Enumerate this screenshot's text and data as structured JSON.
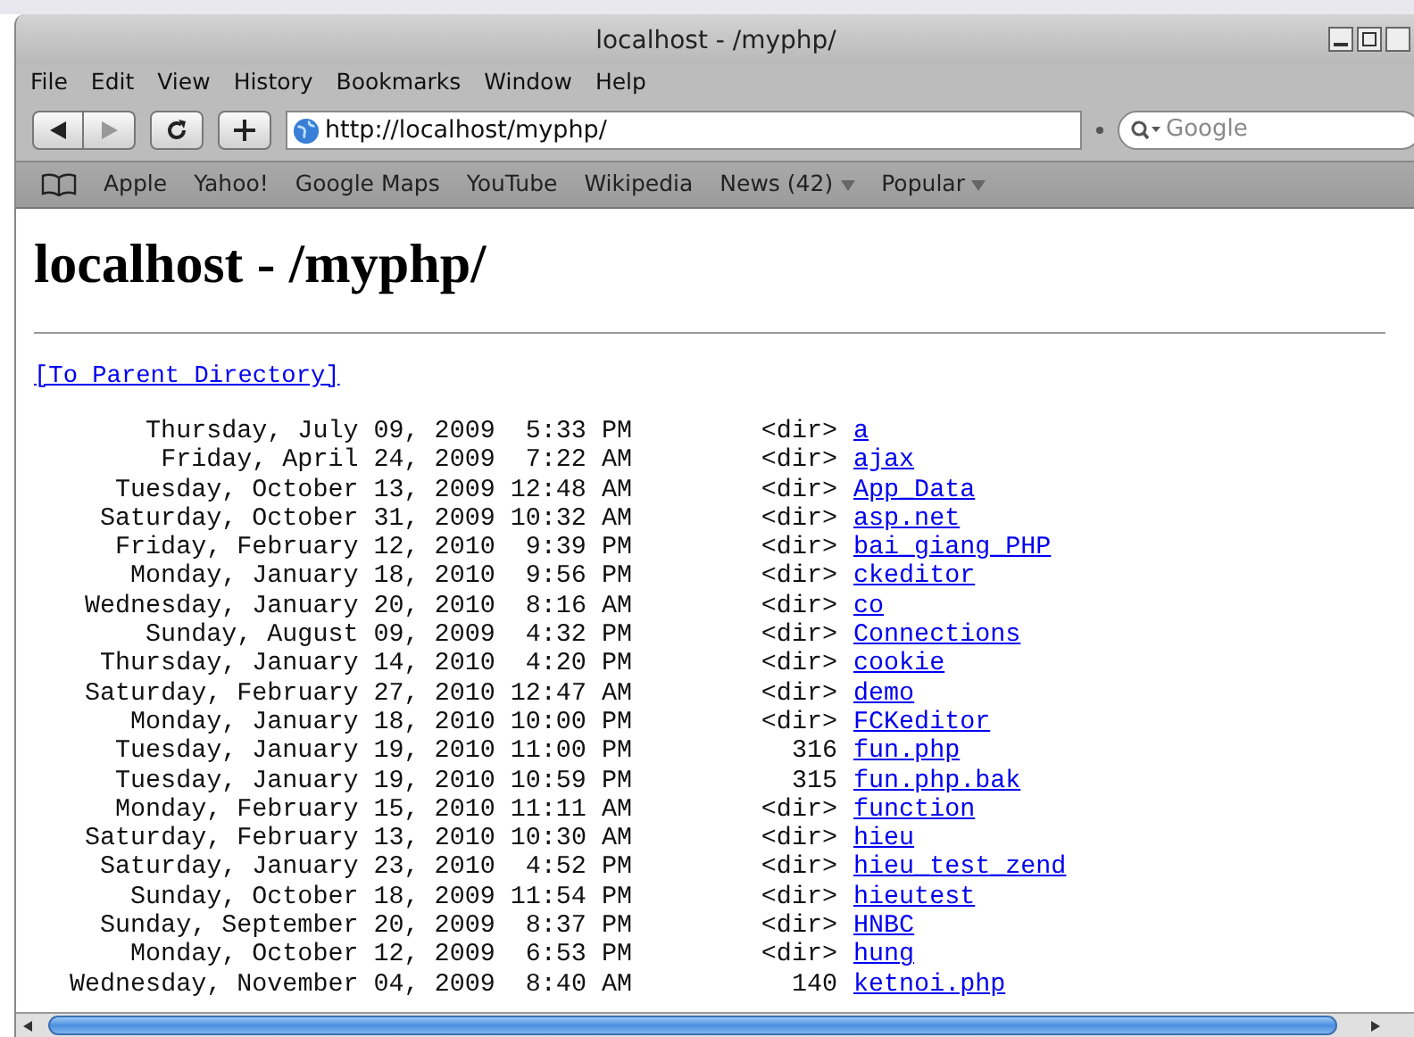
{
  "window": {
    "title": "localhost - /myphp/"
  },
  "menu": [
    "File",
    "Edit",
    "View",
    "History",
    "Bookmarks",
    "Window",
    "Help"
  ],
  "toolbar": {
    "url": "http://localhost/myphp/",
    "search": {
      "placeholder": "Google"
    }
  },
  "bookmarks": [
    {
      "label": "Apple",
      "kind": "link"
    },
    {
      "label": "Yahoo!",
      "kind": "link"
    },
    {
      "label": "Google Maps",
      "kind": "link"
    },
    {
      "label": "YouTube",
      "kind": "link"
    },
    {
      "label": "Wikipedia",
      "kind": "link"
    },
    {
      "label": "News (42)",
      "kind": "menu"
    },
    {
      "label": "Popular",
      "kind": "menu"
    }
  ],
  "page": {
    "heading": "localhost - /myphp/",
    "parent_link": "[To Parent Directory]",
    "rows": [
      {
        "date": "Thursday, July 09, 2009  5:33 PM",
        "size": "<dir>",
        "name": "a"
      },
      {
        "date": "Friday, April 24, 2009  7:22 AM",
        "size": "<dir>",
        "name": "ajax"
      },
      {
        "date": "Tuesday, October 13, 2009 12:48 AM",
        "size": "<dir>",
        "name": "App_Data"
      },
      {
        "date": "Saturday, October 31, 2009 10:32 AM",
        "size": "<dir>",
        "name": "asp.net"
      },
      {
        "date": "Friday, February 12, 2010  9:39 PM",
        "size": "<dir>",
        "name": "bai_giang_PHP"
      },
      {
        "date": "Monday, January 18, 2010  9:56 PM",
        "size": "<dir>",
        "name": "ckeditor"
      },
      {
        "date": "Wednesday, January 20, 2010  8:16 AM",
        "size": "<dir>",
        "name": "co"
      },
      {
        "date": "Sunday, August 09, 2009  4:32 PM",
        "size": "<dir>",
        "name": "Connections"
      },
      {
        "date": "Thursday, January 14, 2010  4:20 PM",
        "size": "<dir>",
        "name": "cookie"
      },
      {
        "date": "Saturday, February 27, 2010 12:47 AM",
        "size": "<dir>",
        "name": "demo"
      },
      {
        "date": "Monday, January 18, 2010 10:00 PM",
        "size": "<dir>",
        "name": "FCKeditor"
      },
      {
        "date": "Tuesday, January 19, 2010 11:00 PM",
        "size": "316",
        "name": "fun.php"
      },
      {
        "date": "Tuesday, January 19, 2010 10:59 PM",
        "size": "315",
        "name": "fun.php.bak"
      },
      {
        "date": "Monday, February 15, 2010 11:11 AM",
        "size": "<dir>",
        "name": "function"
      },
      {
        "date": "Saturday, February 13, 2010 10:30 AM",
        "size": "<dir>",
        "name": "hieu"
      },
      {
        "date": "Saturday, January 23, 2010  4:52 PM",
        "size": "<dir>",
        "name": "hieu_test_zend"
      },
      {
        "date": "Sunday, October 18, 2009 11:54 PM",
        "size": "<dir>",
        "name": "hieutest"
      },
      {
        "date": "Sunday, September 20, 2009  8:37 PM",
        "size": "<dir>",
        "name": "HNBC"
      },
      {
        "date": "Monday, October 12, 2009  6:53 PM",
        "size": "<dir>",
        "name": "hung"
      },
      {
        "date": "Wednesday, November 04, 2009  8:40 AM",
        "size": "140",
        "name": "ketnoi.php"
      }
    ]
  }
}
